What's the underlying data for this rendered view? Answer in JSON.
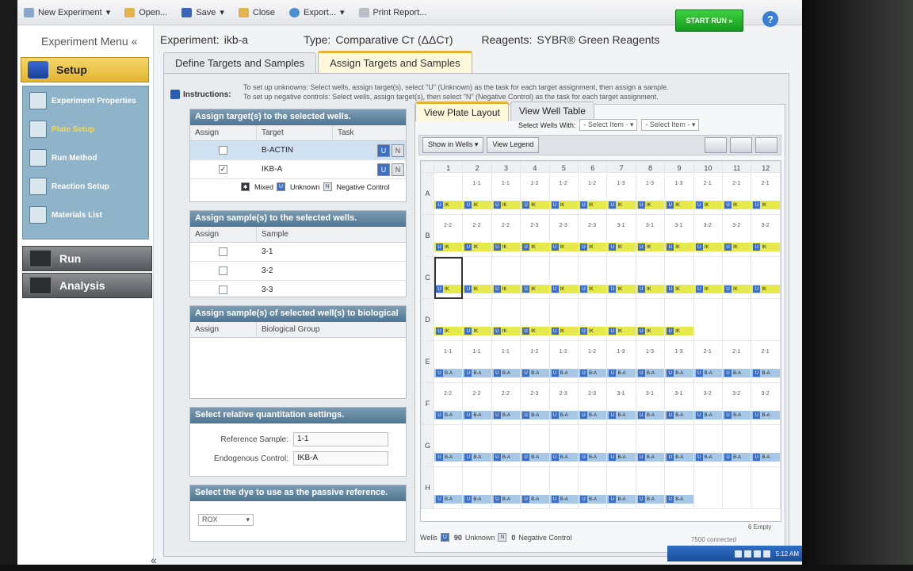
{
  "toolbar": {
    "new_experiment": "New Experiment",
    "open": "Open...",
    "save": "Save",
    "close": "Close",
    "export": "Export...",
    "print_report": "Print Report...",
    "start_run": "START RUN",
    "help": "?"
  },
  "left_nav": {
    "title": "Experiment Menu",
    "collapse": "«",
    "setup": "Setup",
    "setup_items": [
      {
        "label": "Experiment Properties",
        "active": false
      },
      {
        "label": "Plate Setup",
        "active": true
      },
      {
        "label": "Run Method",
        "active": false
      },
      {
        "label": "Reaction Setup",
        "active": false
      },
      {
        "label": "Materials List",
        "active": false
      }
    ],
    "run": "Run",
    "analysis": "Analysis",
    "collapse_bottom": "«"
  },
  "header": {
    "experiment_label": "Experiment:",
    "experiment_value": "ikb-a",
    "type_label": "Type:",
    "type_value": "Comparative Cᴛ (ΔΔCᴛ)",
    "reagents_label": "Reagents:",
    "reagents_value": "SYBR® Green Reagents"
  },
  "tabs": [
    "Define Targets and Samples",
    "Assign Targets and Samples"
  ],
  "instructions": {
    "label": "Instructions:",
    "line1": "To set up unknowns: Select wells, assign target(s), select \"U\" (Unknown) as the task for each target assignment, then assign a sample.",
    "line2": "To set up negative controls: Select wells, assign target(s), then select \"N\" (Negative Control) as the task for each target assignment."
  },
  "targets_panel": {
    "title": "Assign target(s) to the selected wells.",
    "cols": [
      "Assign",
      "Target",
      "Task"
    ],
    "rows": [
      {
        "target": "B-ACTIN",
        "checked": false
      },
      {
        "target": "IKB-A",
        "checked": true
      }
    ],
    "legend_mixed": "Mixed",
    "legend_unknown": "Unknown",
    "legend_neg": "Negative Control",
    "task_u": "U",
    "task_n": "N"
  },
  "samples_panel": {
    "title": "Assign sample(s) to the selected wells.",
    "cols": [
      "Assign",
      "Sample"
    ],
    "rows": [
      "3-1",
      "3-2",
      "3-3"
    ]
  },
  "bio_panel": {
    "title": "Assign sample(s) of selected well(s) to biological",
    "cols": [
      "Assign",
      "Biological Group"
    ]
  },
  "rq_panel": {
    "title": "Select relative quantitation settings.",
    "reference_label": "Reference Sample:",
    "reference_value": "1-1",
    "endogenous_label": "Endogenous Control:",
    "endogenous_value": "IKB-A"
  },
  "dye_panel": {
    "title": "Select the dye to use as the passive reference.",
    "value": "ROX"
  },
  "plate_tabs": [
    "View Plate Layout",
    "View Well Table"
  ],
  "select_wells": {
    "label": "Select Wells With:",
    "opt1": "- Select Item -",
    "opt2": "- Select Item -"
  },
  "plate_toolbar": {
    "show_in_wells": "Show in Wells ▾",
    "view_legend": "View Legend"
  },
  "plate": {
    "columns": [
      "1",
      "2",
      "3",
      "4",
      "5",
      "6",
      "7",
      "8",
      "9",
      "10",
      "11",
      "12"
    ],
    "rows": [
      {
        "label": "A",
        "target": "IK",
        "samples": [
          "",
          "1-1",
          "1-1",
          "1-2",
          "1-2",
          "1-2",
          "1-3",
          "1-3",
          "1-3",
          "2-1",
          "2-1",
          "2-1"
        ]
      },
      {
        "label": "B",
        "target": "IK",
        "samples": [
          "2-2",
          "2-2",
          "2-2",
          "2-3",
          "2-3",
          "2-3",
          "3-1",
          "3-1",
          "3-1",
          "3-2",
          "3-2",
          "3-2"
        ]
      },
      {
        "label": "C",
        "target": "IK",
        "samples": [
          "",
          "",
          "",
          "",
          "",
          "",
          "",
          "",
          "",
          "",
          "",
          ""
        ]
      },
      {
        "label": "D",
        "target": "IK",
        "samples": [
          "",
          "",
          "",
          "",
          "",
          "",
          "",
          "",
          "",
          "",
          "",
          ""
        ]
      },
      {
        "label": "E",
        "target": "B-A",
        "samples": [
          "1-1",
          "1-1",
          "1-1",
          "1-2",
          "1-2",
          "1-2",
          "1-3",
          "1-3",
          "1-3",
          "2-1",
          "2-1",
          "2-1"
        ]
      },
      {
        "label": "F",
        "target": "B-A",
        "samples": [
          "2-2",
          "2-2",
          "2-2",
          "2-3",
          "2-3",
          "2-3",
          "3-1",
          "3-1",
          "3-1",
          "3-2",
          "3-2",
          "3-2"
        ]
      },
      {
        "label": "G",
        "target": "B-A",
        "samples": [
          "",
          "",
          "",
          "",
          "",
          "",
          "",
          "",
          "",
          "",
          "",
          ""
        ]
      },
      {
        "label": "H",
        "target": "B-A",
        "samples": [
          "",
          "",
          "",
          "",
          "",
          "",
          "",
          "",
          "",
          "",
          "",
          ""
        ]
      }
    ],
    "filled": [
      12,
      12,
      12,
      9,
      12,
      12,
      12,
      9
    ],
    "empty_label": "6 Empty",
    "status_wells": "Wells",
    "unknown_count": "90",
    "unknown_label": "Unknown",
    "neg_count": "0",
    "neg_label": "Negative Control"
  },
  "status": {
    "connected": "7500 connected",
    "clock": "5:12 AM"
  },
  "colors": {
    "accent": "#e3b431",
    "start_run": "#1fae27",
    "unknown_task": "#3d6fc4",
    "ikba_well": "#e6e94c",
    "bactin_well": "#a6c8e6"
  }
}
